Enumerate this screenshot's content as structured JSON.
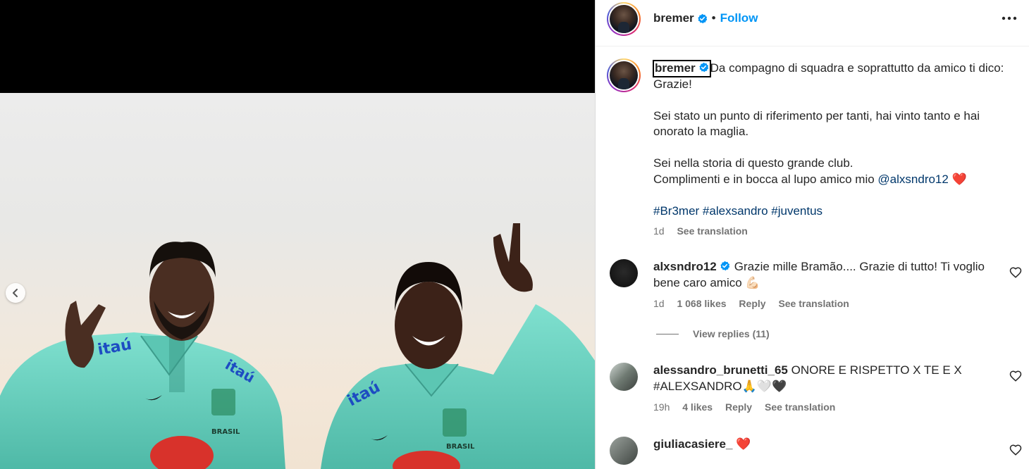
{
  "post": {
    "username": "bremer",
    "follow_label": "Follow",
    "separator": "•"
  },
  "caption": {
    "username": "bremer",
    "line1": "Da compagno di squadra e soprattutto da amico ti dico: Grazie!",
    "line2": "Sei stato un punto di riferimento per tanti, hai vinto tanto e hai onorato la maglia.",
    "line3": "Sei nella storia di questo grande club.",
    "line4_prefix": "Complimenti e in bocca al lupo amico mio ",
    "mention": "@alxsndro12",
    "emoji": "❤️",
    "hashtags": [
      "#Br3mer",
      "#alexsandro",
      "#juventus"
    ],
    "time": "1d",
    "see_translation": "See translation"
  },
  "comments": [
    {
      "username": "alxsndro12",
      "verified": true,
      "text": "Grazie mille Bramão.... Grazie di tutto! Ti voglio bene caro amico 💪🏻",
      "time": "1d",
      "likes": "1 068 likes",
      "reply": "Reply",
      "see_translation": "See translation",
      "view_replies": "View replies (11)"
    },
    {
      "username": "alessandro_brunetti_65",
      "verified": false,
      "text": "ONORE E RISPETTO X TE E X #ALEXSANDRO🙏🤍🖤",
      "time": "19h",
      "likes": "4 likes",
      "reply": "Reply",
      "see_translation": "See translation"
    },
    {
      "username": "giuliacasiere_",
      "verified": false,
      "text": "❤️"
    }
  ],
  "colors": {
    "link_blue": "#0095f6",
    "hashtag": "#00376b",
    "muted": "#737373",
    "jersey": "#6fd3c0"
  },
  "icons": [
    "verified-badge-icon",
    "more-options-icon",
    "heart-icon",
    "chevron-left-icon"
  ]
}
